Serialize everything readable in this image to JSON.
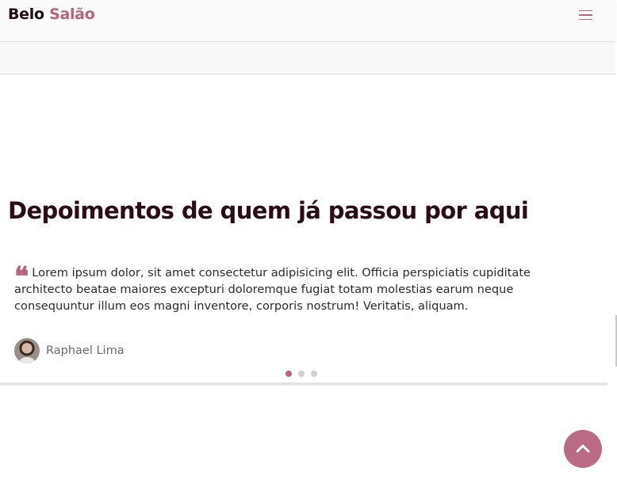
{
  "navbar": {
    "brand_part1": "Belo",
    "brand_part2": "Salão",
    "menu_icon": "hamburger-icon"
  },
  "testimonials": {
    "heading": "Depoimentos de quem já passou por aqui",
    "quote_icon": "quote-icon",
    "active_quote": "Lorem ipsum dolor, sit amet consectetur adipisicing elit. Officia perspiciatis cupiditate architecto beatae maiores excepturi doloremque fugiat totam molestias earum neque consequuntur illum eos magni inventore, corporis nostrum! Veritatis, aliquam.",
    "author_name": "Raphael Lima",
    "slides_total": 3,
    "active_slide": 1
  },
  "back_to_top": {
    "icon": "chevron-up-icon"
  },
  "colors": {
    "accent": "#b5657f",
    "heading": "#2a0d17",
    "button": "#bb6a86"
  }
}
